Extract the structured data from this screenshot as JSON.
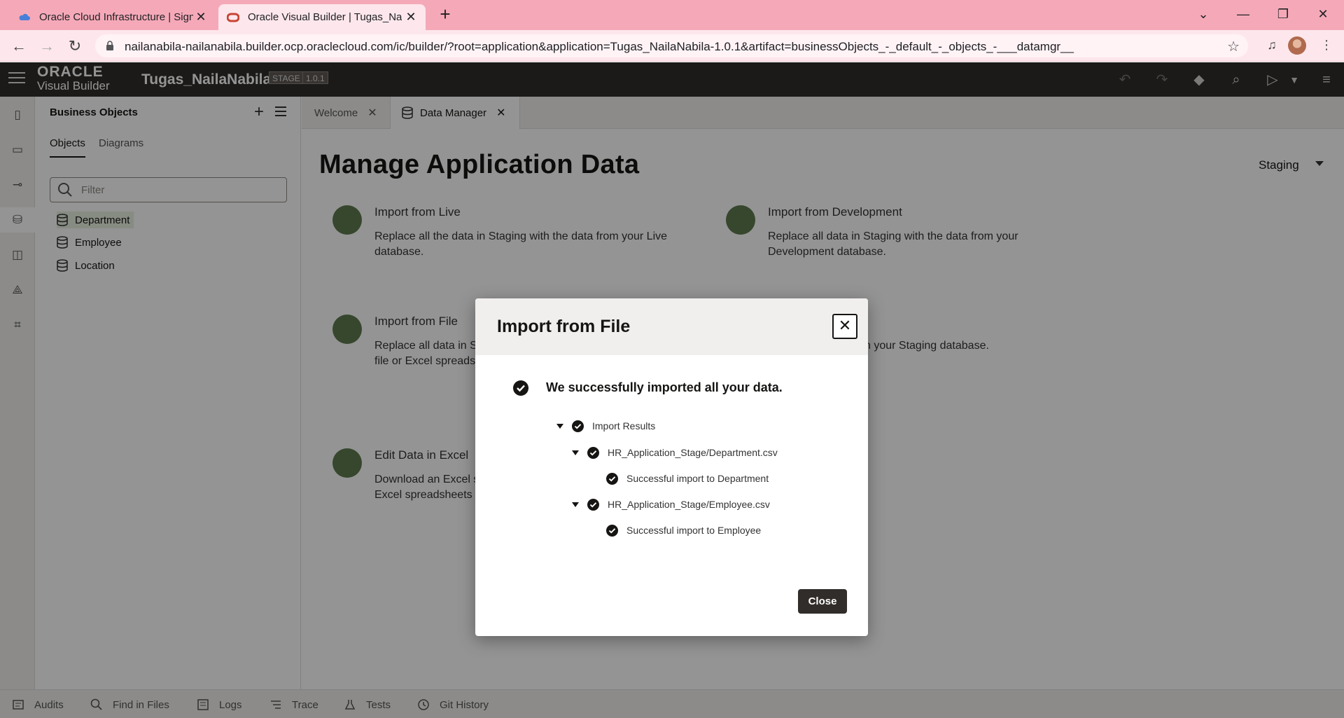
{
  "browser": {
    "tabs": [
      {
        "title": "Oracle Cloud Infrastructure | Sign"
      },
      {
        "title": "Oracle Visual Builder | Tugas_NailaNabila"
      }
    ],
    "url": "nailanabila-nailanabila.builder.ocp.oraclecloud.com/ic/builder/?root=application&application=Tugas_NailaNabila-1.0.1&artifact=businessObjects_-_default_-_objects_-___datamgr__"
  },
  "header": {
    "logo_top": "ORACLE",
    "logo_bottom": "Visual Builder",
    "app_name": "Tugas_NailaNabila",
    "stage_badge": "STAGE",
    "version_badge": "1.0.1"
  },
  "sidebar": {
    "title": "Business Objects",
    "tabs": [
      "Objects",
      "Diagrams"
    ],
    "filter_placeholder": "Filter",
    "items": [
      "Department",
      "Employee",
      "Location"
    ]
  },
  "editor_tabs": [
    "Welcome",
    "Data Manager"
  ],
  "main": {
    "title": "Manage Application Data",
    "environment": "Staging",
    "cards": [
      {
        "title": "Import from Live",
        "desc1": "Replace all the data in Staging with the data from your Live",
        "desc2": "database."
      },
      {
        "title": "Import from Development",
        "desc1": "Replace all data in Staging with the data from your",
        "desc2": "Development database."
      },
      {
        "title": "Import from File",
        "desc1": "Replace all data in S",
        "desc2": "file or Excel spreads"
      },
      {
        "title": "",
        "desc1": "n your Staging database.",
        "desc2": ""
      },
      {
        "title": "Edit Data in Excel",
        "desc1": "Download an Excel s",
        "desc2": "Excel spreadsheets"
      }
    ]
  },
  "footer": [
    "Audits",
    "Find in Files",
    "Logs",
    "Trace",
    "Tests",
    "Git History"
  ],
  "dialog": {
    "title": "Import from File",
    "message": "We successfully imported all your data.",
    "tree": {
      "root": "Import Results",
      "file1": "HR_Application_Stage/Department.csv",
      "result1": "Successful import to Department",
      "file2": "HR_Application_Stage/Employee.csv",
      "result2": "Successful import to Employee"
    },
    "close_label": "Close"
  },
  "colors": {
    "header_bg": "#312d2a",
    "chrome_tab_bar": "#f5a9b8",
    "accent_green": "#5d7b4f"
  }
}
